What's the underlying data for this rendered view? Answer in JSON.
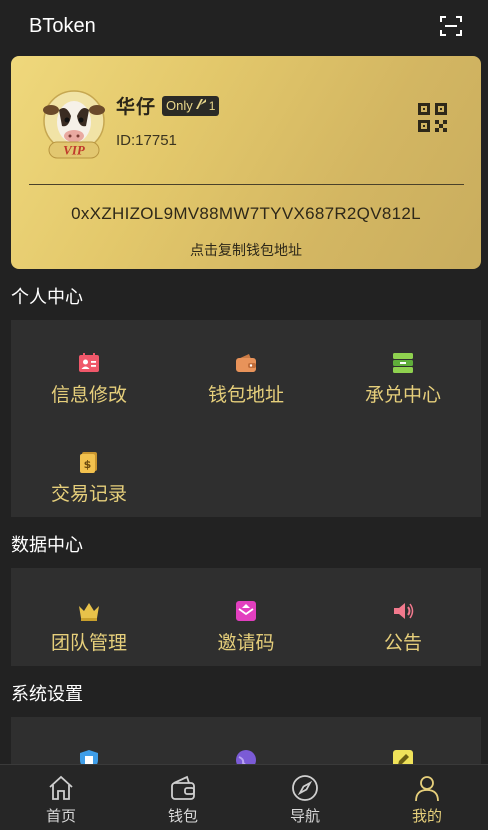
{
  "header": {
    "title": "BToken",
    "scan_icon": "scan-icon"
  },
  "card": {
    "name": "华仔",
    "badge_text": "Only",
    "badge_mark": "1",
    "vip_label": "VIP",
    "uid": "ID:17751",
    "address": "0xXZHIZOL9MV88MW7TYVX687R2QV812L",
    "copy_hint": "点击复制钱包地址",
    "qr_icon": "qr-code-icon"
  },
  "personal": {
    "title": "个人中心",
    "items": [
      {
        "label": "信息修改",
        "icon": "id-card-icon"
      },
      {
        "label": "钱包地址",
        "icon": "wallet-icon"
      },
      {
        "label": "承兑中心",
        "icon": "server-icon"
      },
      {
        "label": "交易记录",
        "icon": "ledger-icon"
      }
    ]
  },
  "data_center": {
    "title": "数据中心",
    "items": [
      {
        "label": "团队管理",
        "icon": "crown-icon"
      },
      {
        "label": "邀请码",
        "icon": "mail-icon"
      },
      {
        "label": "公告",
        "icon": "speaker-icon"
      }
    ]
  },
  "system": {
    "title": "系统设置",
    "items": [
      {
        "icon": "shield-icon"
      },
      {
        "icon": "globe-icon"
      },
      {
        "icon": "edit-icon"
      }
    ]
  },
  "nav": [
    {
      "label": "首页",
      "icon": "home-icon",
      "active": false
    },
    {
      "label": "钱包",
      "icon": "wallet-icon",
      "active": false
    },
    {
      "label": "导航",
      "icon": "compass-icon",
      "active": false
    },
    {
      "label": "我的",
      "icon": "user-icon",
      "active": true
    }
  ],
  "colors": {
    "accent": "#e6cf7b",
    "background": "#222222",
    "panel": "#2f2f2f",
    "card_gold": "#e3c86b"
  }
}
